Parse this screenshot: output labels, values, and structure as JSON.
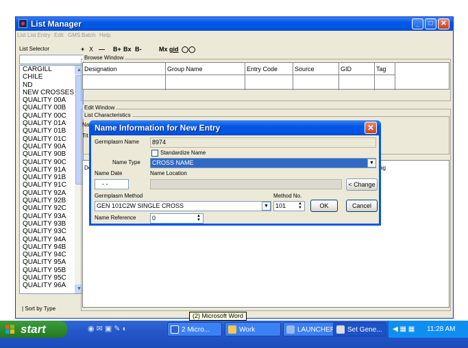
{
  "window": {
    "title": "List Manager",
    "buttons": {
      "minimize": "_",
      "maximize": "□",
      "close": "✕"
    }
  },
  "menubar": [
    "List",
    "List Entry",
    "Edit",
    "GMS",
    "Batch",
    "Help"
  ],
  "toolbar": [
    "+",
    "X",
    "—",
    "B+",
    "Bx",
    "B-",
    "Mx",
    "gid"
  ],
  "list_selector": {
    "label": "List Selector",
    "items": [
      "CARGILL",
      "CHILE",
      "ND",
      "NEW CROSSES",
      "QUALITY 00A",
      "QUALITY 00B",
      "QUALITY 00C",
      "QUALITY 01A",
      "QUALITY 01B",
      "QUALITY 01C",
      "QUALITY 90A",
      "QUALITY 90B",
      "QUALITY 90C",
      "QUALITY 91A",
      "QUALITY 91B",
      "QUALITY 91C",
      "QUALITY 92A",
      "QUALITY 92B",
      "QUALITY 92C",
      "QUALITY 93A",
      "QUALITY 93B",
      "QUALITY 93C",
      "QUALITY 94A",
      "QUALITY 94B",
      "QUALITY 94C",
      "QUALITY 95A",
      "QUALITY 95B",
      "QUALITY 95C",
      "QUALITY 96A"
    ],
    "sort_label": "Sort by Type"
  },
  "browse": {
    "label": "Browse Window",
    "columns": [
      "Designation",
      "Group Name",
      "Entry Code",
      "Source",
      "GID",
      "Tag"
    ]
  },
  "edit": {
    "label": "Edit Window",
    "list_characteristics_label": "List Characteristics",
    "partial_na": "Na",
    "partial_tit": "Tit",
    "partial_de": "De",
    "partial_ag": "ag"
  },
  "dialog": {
    "title": "Name Information for New Entry",
    "germplasm_name_label": "Germplasm Name",
    "germplasm_name_value": "8974",
    "standardize_label": "Standardize Name",
    "standardize_checked": false,
    "name_type_label": "Name Type",
    "name_type_value": "CROSS NAME",
    "name_date_label": "Name Date",
    "name_date_value": "- -",
    "name_location_label": "Name Location",
    "name_location_value": "",
    "change_button": "< Change",
    "germplasm_method_label": "Germplasm Method",
    "germplasm_method_value": "GEN 101C2W SINGLE CROSS",
    "method_no_label": "Method No.",
    "method_no_value": "101",
    "name_reference_label": "Name Reference",
    "name_reference_value": "0",
    "ok_button": "OK",
    "cancel_button": "Cancel"
  },
  "taskbar": {
    "start": "start",
    "tasks": [
      "2 Micro...",
      "Work",
      "LAUNCHER",
      "Set Gene..."
    ],
    "clock": "11:28 AM",
    "tooltip": "(2) Microsoft Word"
  },
  "colors": {
    "titlebar": "#0054e3",
    "selection": "#316ac5",
    "taskbar": "#2457c9",
    "start": "#2e8b2e"
  }
}
